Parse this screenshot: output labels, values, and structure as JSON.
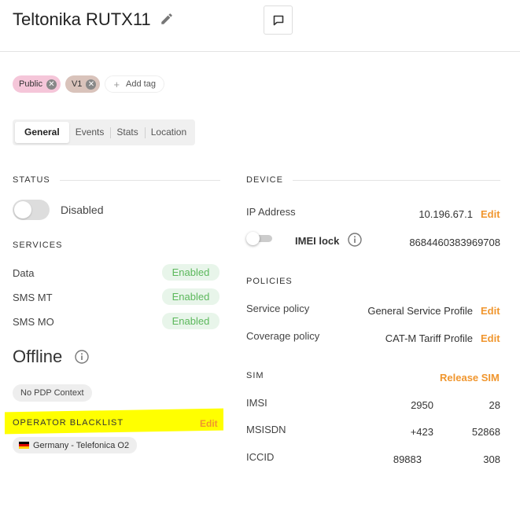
{
  "header": {
    "title": "Teltonika RUTX11",
    "icons": {
      "edit": "pencil-icon",
      "comment": "comment-icon"
    }
  },
  "tags": {
    "items": [
      {
        "label": "Public",
        "color": "#f5c6d9"
      },
      {
        "label": "V1",
        "color": "#d9c3bb"
      }
    ],
    "add_label": "Add tag"
  },
  "tabs": [
    "General",
    "Events",
    "Stats",
    "Location"
  ],
  "status": {
    "heading": "STATUS",
    "toggle_label": "Disabled",
    "toggle_on": false
  },
  "services": {
    "heading": "SERVICES",
    "items": [
      {
        "label": "Data",
        "status": "Enabled"
      },
      {
        "label": "SMS MT",
        "status": "Enabled"
      },
      {
        "label": "SMS MO",
        "status": "Enabled"
      }
    ]
  },
  "connection": {
    "state": "Offline",
    "badge": "No PDP Context"
  },
  "operator_blacklist": {
    "heading": "OPERATOR BLACKLIST",
    "edit": "Edit",
    "items": [
      {
        "label": "Germany - Telefonica O2",
        "flag": "germany-flag"
      }
    ]
  },
  "device": {
    "heading": "DEVICE",
    "ip_label": "IP Address",
    "ip_value": "10.196.67.1",
    "ip_edit": "Edit",
    "imei_lock_label": "IMEI lock",
    "imei_value": "8684460383969708"
  },
  "policies": {
    "heading": "POLICIES",
    "service_label": "Service policy",
    "service_value": "General Service Profile",
    "service_edit": "Edit",
    "coverage_label": "Coverage policy",
    "coverage_value": "CAT-M Tariff Profile",
    "coverage_edit": "Edit"
  },
  "sim": {
    "heading": "SIM",
    "release": "Release SIM",
    "imsi_label": "IMSI",
    "imsi_a": "2950",
    "imsi_b": "28",
    "msisdn_label": "MSISDN",
    "msisdn_a": "+423",
    "msisdn_b": "52868",
    "iccid_label": "ICCID",
    "iccid_a": "89883",
    "iccid_b": "308"
  },
  "colors": {
    "accent": "#f0962e",
    "enabled_text": "#5cb85c",
    "enabled_bg": "#e8f5ea",
    "highlight": "#ffff00"
  }
}
